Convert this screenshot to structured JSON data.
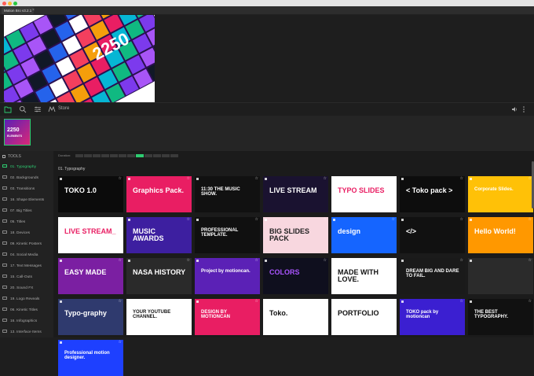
{
  "window": {
    "tab_title": "Motion Bro v3.2.1",
    "tab_close": "×"
  },
  "colors": {
    "accent_green": "#2ecc71"
  },
  "toolbar": {
    "store_label": "Store",
    "icons": [
      "folder-icon",
      "search-icon",
      "sliders-icon",
      "store-icon",
      "volume-icon",
      "menu-dots-icon"
    ]
  },
  "thumbnail": {
    "label": "2250",
    "sub": "ELEMENTS"
  },
  "sidebar": {
    "heading": "TOOLS",
    "items": [
      {
        "label": "01. Typography",
        "active": true
      },
      {
        "label": "02. Backgrounds"
      },
      {
        "label": "03. Transitions"
      },
      {
        "label": "16. Shape Elements"
      },
      {
        "label": "07. Big Titles"
      },
      {
        "label": "05. Titles"
      },
      {
        "label": "18. Devices"
      },
      {
        "label": "09. Kinetic Posters"
      },
      {
        "label": "04. Social Media"
      },
      {
        "label": "17. Text Messages"
      },
      {
        "label": "15. Call-Outs"
      },
      {
        "label": "20. Sound FX"
      },
      {
        "label": "19. Logo Reveals"
      },
      {
        "label": "06. Kinetic Titles"
      },
      {
        "label": "16. Infographics"
      },
      {
        "label": "13. Interface Items"
      }
    ]
  },
  "main": {
    "duration_label": "Duration:",
    "section_title": "01. Typography",
    "cards": [
      {
        "text": "TOKO 1.0",
        "bg": "#0b0b0b",
        "fg": "#ffffff"
      },
      {
        "text": "Graphics Pack.",
        "bg": "#e91e63",
        "fg": "#ffffff"
      },
      {
        "text": "11:30 THE MUSIC SHOW.",
        "bg": "#111111",
        "fg": "#ffffff"
      },
      {
        "text": "LIVE STREAM",
        "bg": "#1a1230",
        "fg": "#ffffff"
      },
      {
        "text": "TYPO SLIDES",
        "bg": "#ffffff",
        "fg": "#e91e63"
      },
      {
        "text": "< Toko pack >",
        "bg": "#0d0d0d",
        "fg": "#ffffff"
      },
      {
        "text": "Corporate Slides.",
        "bg": "#ffc107",
        "fg": "#ffffff"
      },
      {
        "text": "LIVE STREAM_",
        "bg": "#ffffff",
        "fg": "#e91e63"
      },
      {
        "text": "MUSIC AWARDS",
        "bg": "#3d1fa0",
        "fg": "#ffffff"
      },
      {
        "text": "PROFESSIONAL TEMPLATE.",
        "bg": "#101010",
        "fg": "#ffffff"
      },
      {
        "text": "BIG SLIDES PACK",
        "bg": "#f8d7df",
        "fg": "#222222"
      },
      {
        "text": "design",
        "bg": "#1565ff",
        "fg": "#ffffff"
      },
      {
        "text": "</>",
        "bg": "#111111",
        "fg": "#ffffff"
      },
      {
        "text": "Hello World!",
        "bg": "#ff9800",
        "fg": "#ffffff"
      },
      {
        "text": "EASY MADE",
        "bg": "#7b1fa2",
        "fg": "#ffffff"
      },
      {
        "text": "NASA HISTORY",
        "bg": "#2a2a2a",
        "fg": "#ffffff"
      },
      {
        "text": "Project by motioncan.",
        "bg": "#5b21b6",
        "fg": "#ffffff"
      },
      {
        "text": "COLORS",
        "bg": "#0f0f1e",
        "fg": "#a5f"
      },
      {
        "text": "MADE WITH LOVE.",
        "bg": "#ffffff",
        "fg": "#111111"
      },
      {
        "text": "DREAM BIG AND DARE TO FAIL.",
        "bg": "#1a1a1a",
        "fg": "#ffffff"
      },
      {
        "text": "",
        "bg": "#2b2b2b",
        "fg": "#ffffff"
      },
      {
        "text": "Typo-graphy",
        "bg": "#2f3a6e",
        "fg": "#ffffff"
      },
      {
        "text": "YOUR YOUTUBE CHANNEL.",
        "bg": "#ffffff",
        "fg": "#111111"
      },
      {
        "text": "DESIGN BY MOTIONCAN",
        "bg": "#e91e63",
        "fg": "#ffffff"
      },
      {
        "text": "Toko.",
        "bg": "#ffffff",
        "fg": "#111111"
      },
      {
        "text": "PORTFOLIO",
        "bg": "#ffffff",
        "fg": "#111111"
      },
      {
        "text": "TOKO pack by motioncan",
        "bg": "#3b1fd1",
        "fg": "#ffffff"
      },
      {
        "text": "THE BEST TYPOGRAPHY.",
        "bg": "#111111",
        "fg": "#ffffff"
      },
      {
        "text": "Professional motion designer.",
        "bg": "#1e40ff",
        "fg": "#ffffff"
      }
    ]
  }
}
